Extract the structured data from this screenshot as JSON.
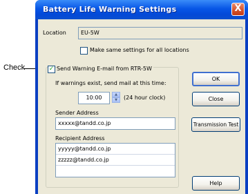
{
  "callout": {
    "label": "Check"
  },
  "window": {
    "title": "Battery Life Warning Settings",
    "close_glyph": "X"
  },
  "location": {
    "label": "Location",
    "value": "EU-5W"
  },
  "same_settings": {
    "label": "Make same settings for all locations",
    "checked": false
  },
  "send_email": {
    "label": "Send Warning E-mail from RTR-5W",
    "checked": true
  },
  "schedule": {
    "label": "If warnings exist, send mail at this time:",
    "time": "10:00",
    "format_note": "(24 hour clock)"
  },
  "sender": {
    "label": "Sender Address",
    "value": "xxxxx@tandd.co.jp"
  },
  "recipient": {
    "label": "Recipient Address",
    "items": [
      "yyyyy@tandd.co.jp",
      "zzzzz@tandd.co.jp",
      ""
    ]
  },
  "buttons": {
    "ok": "OK",
    "close": "Close",
    "transmission_test": "Transmission Test",
    "help": "Help"
  },
  "colors": {
    "title_bar": "#0756e6",
    "client_bg": "#ece9d8",
    "check_mark": "#21a121"
  }
}
